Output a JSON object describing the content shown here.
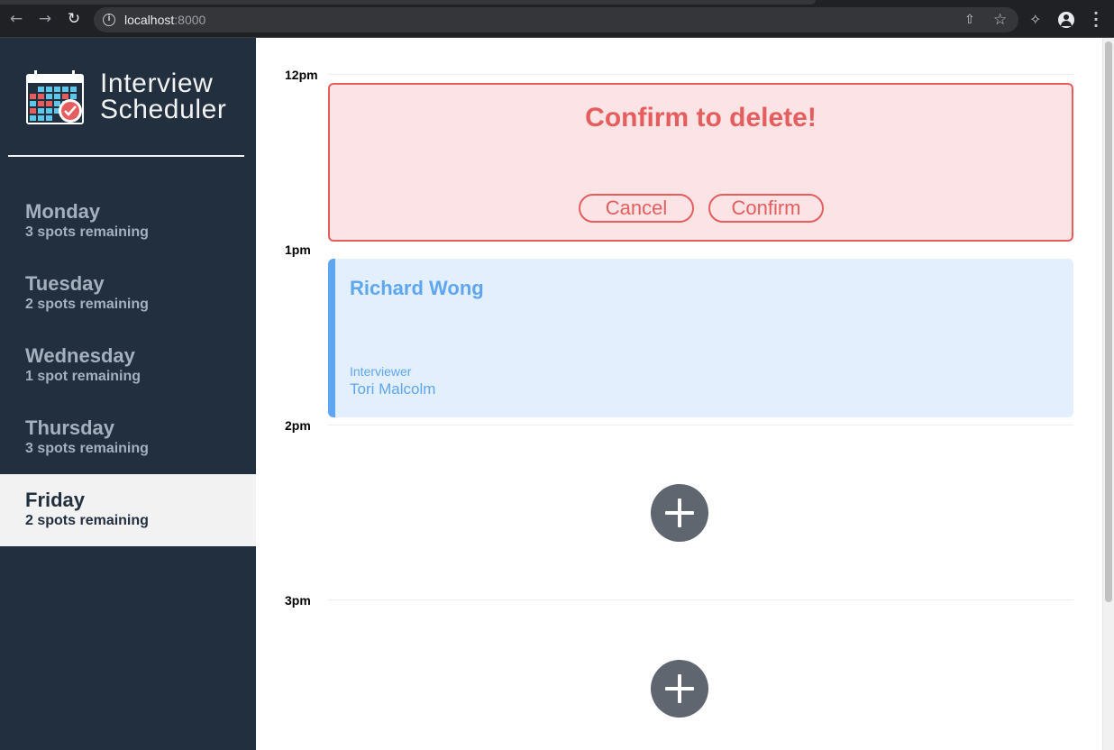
{
  "browser": {
    "host": "localhost",
    "port": ":8000",
    "icons": [
      "back-arrow-icon",
      "forward-arrow-icon",
      "reload-icon",
      "info-icon",
      "share-icon",
      "star-icon",
      "puzzle-icon",
      "profile-icon",
      "kebab-menu-icon"
    ]
  },
  "brand": {
    "line1": "Interview",
    "line2": "Scheduler"
  },
  "days": [
    {
      "name": "Monday",
      "spots": "3 spots remaining"
    },
    {
      "name": "Tuesday",
      "spots": "2 spots remaining"
    },
    {
      "name": "Wednesday",
      "spots": "1 spot remaining"
    },
    {
      "name": "Thursday",
      "spots": "3 spots remaining"
    },
    {
      "name": "Friday",
      "spots": "2 spots remaining",
      "selected": true
    }
  ],
  "schedule": {
    "times": [
      "12pm",
      "1pm",
      "2pm",
      "3pm"
    ],
    "confirm": {
      "message": "Confirm to delete!",
      "cancel_label": "Cancel",
      "confirm_label": "Confirm"
    },
    "appointment": {
      "student": "Richard Wong",
      "interviewer_label": "Interviewer",
      "interviewer": "Tori Malcolm"
    }
  },
  "colors": {
    "sidebar_bg": "#222f3e",
    "danger": "#e65d5e",
    "danger_bg": "#fbe3e6",
    "appointment_accent": "#5fa6f0",
    "appointment_bg": "#e3effc",
    "add_button": "#5f6670"
  }
}
